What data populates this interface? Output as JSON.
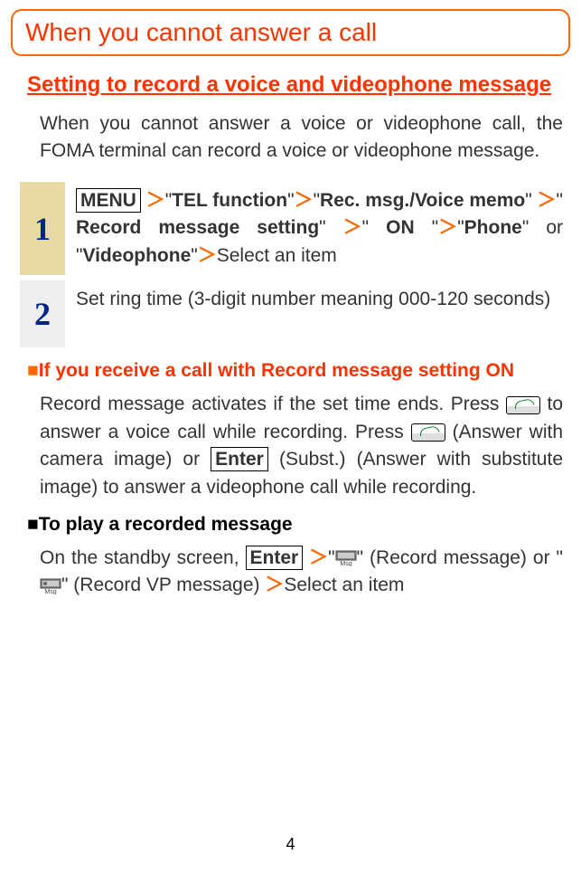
{
  "title": "When you cannot answer a call",
  "section_heading": "Setting to record a voice and videophone message",
  "intro": "When you cannot answer a voice or videophone call, the FOMA terminal can record a voice or videophone message.",
  "steps": {
    "s1": {
      "num": "1",
      "menu": "MENU",
      "gt": "＞",
      "q": "\"",
      "tel_function": "TEL function",
      "rec_msg": "Rec. msg./Voice memo",
      "record_msg_setting": " Record message setting",
      "on": " ON ",
      "phone": "Phone",
      "or": " or ",
      "videophone": "Videophone",
      "select_item": "Select an item"
    },
    "s2": {
      "num": "2",
      "text": "Set ring time (3-digit number meaning 000-120 seconds)"
    }
  },
  "sub1": {
    "heading": "If you receive a call with Record message setting ON",
    "body_a": "Record message activates if the set time ends. Press ",
    "body_b": " to answer a voice call while recording. Press ",
    "body_c": " (Answer with camera image) or ",
    "enter": "Enter",
    "body_d": " (Subst.) (Answer with substitute image) to answer a videophone call while recording."
  },
  "sub2": {
    "heading": "To play a recorded message",
    "body_a": "On the standby screen, ",
    "enter": "Enter",
    "gt": " ＞",
    "q": "\"",
    "rec_msg_label": " (Record message) or ",
    "rec_vp_label": " (Record VP message) ",
    "select_item": "Select an item"
  },
  "page_number": "4",
  "square": "■"
}
